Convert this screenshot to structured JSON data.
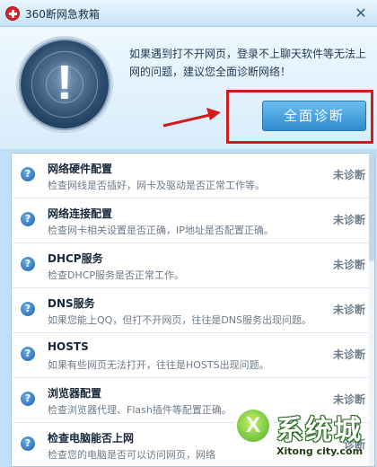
{
  "window": {
    "title": "360断网急救箱",
    "close_glyph": "✕"
  },
  "header": {
    "hint": "如果遇到打不开网页，登录不上聊天软件等无法上网的问题，建议您全面诊断网络！",
    "diagnose_button": "全面诊断",
    "radar_glyph": "!"
  },
  "items": [
    {
      "title": "网络硬件配置",
      "desc": "检查网线是否插好，网卡及驱动是否正常工作等。",
      "status": "未诊断"
    },
    {
      "title": "网络连接配置",
      "desc": "检查网卡相关设置是否正确，IP地址是否配置正确。",
      "status": "未诊断"
    },
    {
      "title": "DHCP服务",
      "desc": "检查DHCP服务是否正常工作。",
      "status": "未诊断"
    },
    {
      "title": "DNS服务",
      "desc": "如果您能上QQ，但打不开网页，往往是DNS服务出现问题。",
      "status": "未诊断"
    },
    {
      "title": "HOSTS",
      "desc": "如果有些网页无法打开，往往是HOSTS出现问题。",
      "status": "未诊断"
    },
    {
      "title": "浏览器配置",
      "desc": "检查浏览器代理、Flash插件等配置正确。",
      "status": "未诊断"
    },
    {
      "title": "检查电脑能否上网",
      "desc": "检查您的电脑是否可以访问网页，网络",
      "status": "诊断"
    }
  ],
  "icons": {
    "item_icon": "question-icon",
    "item_icon_glyph": "?"
  },
  "watermark": {
    "text": "系统城",
    "url": "Xitong city.com"
  },
  "colors": {
    "accent_blue": "#2f8bd0",
    "highlight_red": "#d01c1c"
  }
}
